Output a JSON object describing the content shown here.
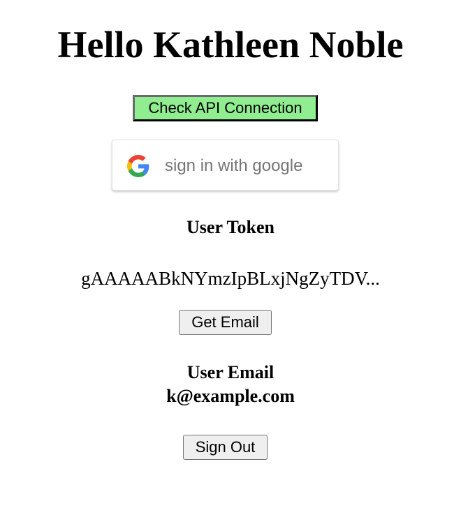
{
  "header": {
    "greeting": "Hello Kathleen Noble"
  },
  "api": {
    "check_label": "Check API Connection",
    "button_color": "#90ee90"
  },
  "google_signin": {
    "label": "sign in with google",
    "icon": "google-g-icon"
  },
  "token": {
    "title": "User Token",
    "value": "gAAAAABkNYmzIpBLxjNgZyTDV..."
  },
  "actions": {
    "get_email_label": "Get Email",
    "sign_out_label": "Sign Out"
  },
  "email": {
    "title": "User Email",
    "value": "k@example.com"
  }
}
